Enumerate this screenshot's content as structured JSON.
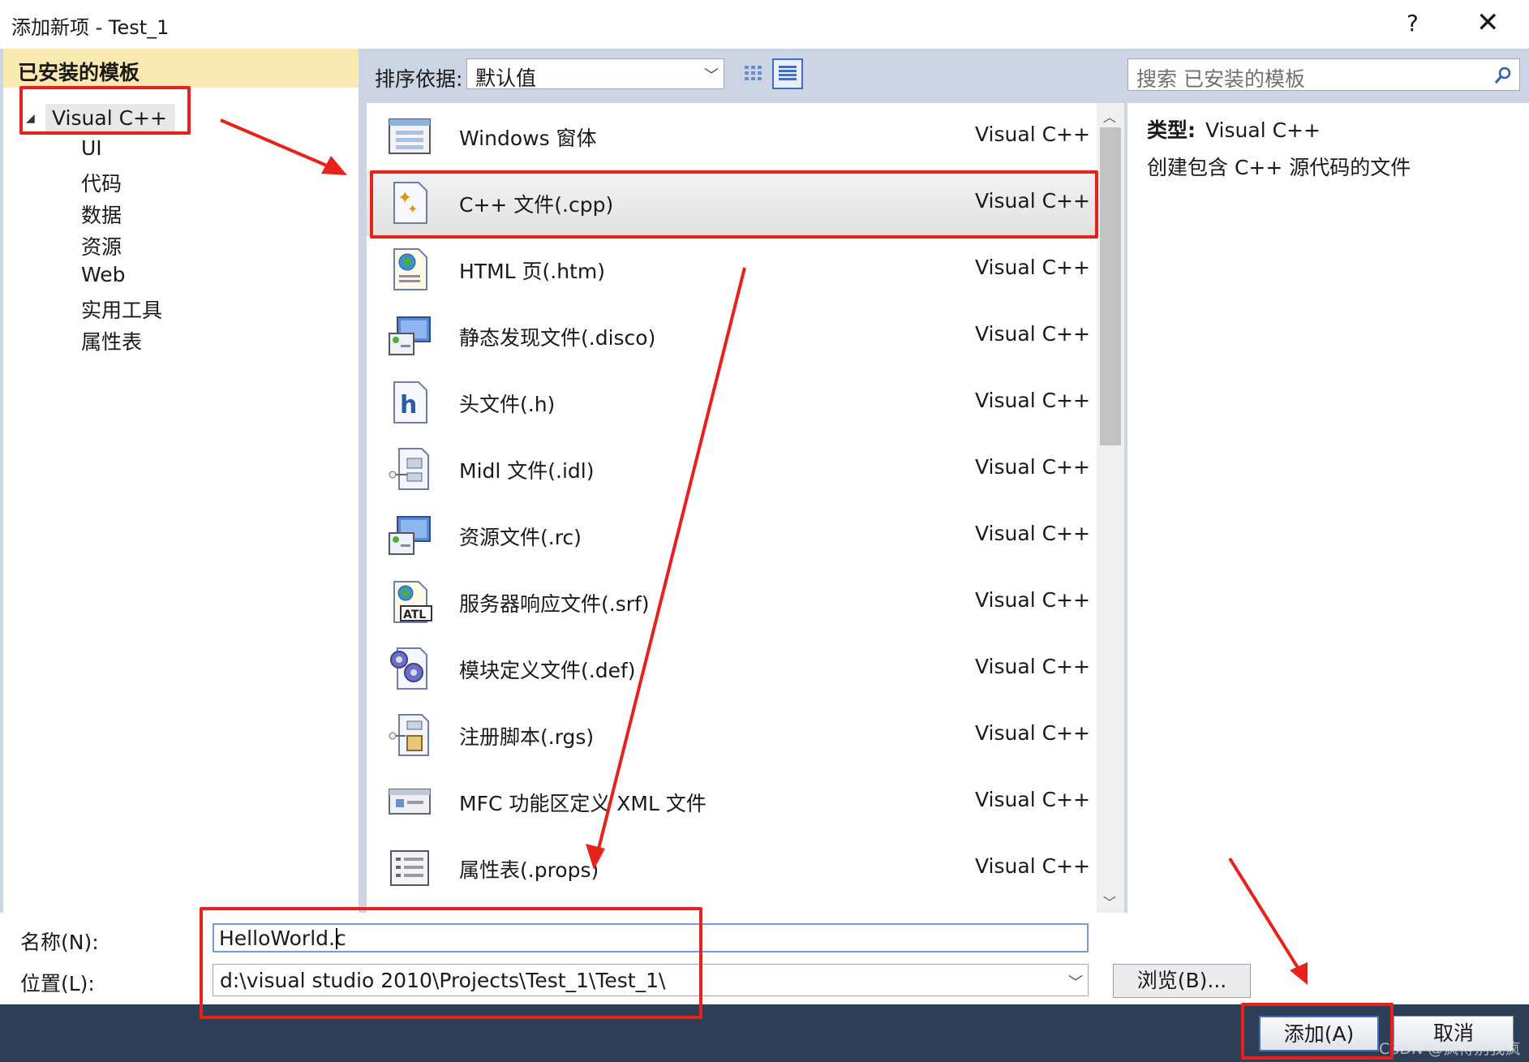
{
  "window": {
    "title": "添加新项 - Test_1",
    "help": "?",
    "close": "✕"
  },
  "left_panel": {
    "header": "已安装的模板",
    "root": "Visual C++",
    "children": [
      "UI",
      "代码",
      "数据",
      "资源",
      "Web",
      "实用工具",
      "属性表"
    ]
  },
  "toolbar": {
    "sort_label": "排序依据:",
    "sort_value": "默认值",
    "search_placeholder": "搜索 已安装的模板"
  },
  "templates": [
    {
      "name": "Windows 窗体",
      "type": "Visual C++",
      "icon": "form-icon"
    },
    {
      "name": "C++ 文件(.cpp)",
      "type": "Visual C++",
      "icon": "cpp-file-icon"
    },
    {
      "name": "HTML 页(.htm)",
      "type": "Visual C++",
      "icon": "html-page-icon"
    },
    {
      "name": "静态发现文件(.disco)",
      "type": "Visual C++",
      "icon": "disco-file-icon"
    },
    {
      "name": "头文件(.h)",
      "type": "Visual C++",
      "icon": "header-file-icon"
    },
    {
      "name": "Midl 文件(.idl)",
      "type": "Visual C++",
      "icon": "idl-file-icon"
    },
    {
      "name": "资源文件(.rc)",
      "type": "Visual C++",
      "icon": "resource-file-icon"
    },
    {
      "name": "服务器响应文件(.srf)",
      "type": "Visual C++",
      "icon": "atl-srf-icon"
    },
    {
      "name": "模块定义文件(.def)",
      "type": "Visual C++",
      "icon": "def-file-icon"
    },
    {
      "name": "注册脚本(.rgs)",
      "type": "Visual C++",
      "icon": "rgs-script-icon"
    },
    {
      "name": "MFC 功能区定义 XML 文件",
      "type": "Visual C++",
      "icon": "ribbon-xml-icon"
    },
    {
      "name": "属性表(.props)",
      "type": "Visual C++",
      "icon": "props-sheet-icon"
    }
  ],
  "selected_template": "C++ 文件(.cpp)",
  "details": {
    "type_label": "类型:",
    "type_value": "Visual C++",
    "description": "创建包含 C++ 源代码的文件"
  },
  "fields": {
    "name_label": "名称(N):",
    "name_value": "HelloWorld.c",
    "location_label": "位置(L):",
    "location_value": "d:\\visual studio 2010\\Projects\\Test_1\\Test_1\\"
  },
  "buttons": {
    "browse": "浏览(B)...",
    "add": "添加(A)",
    "cancel": "取消"
  },
  "watermark": "CSDN @疯得别我疯",
  "colors": {
    "annotation": "#e8221b",
    "left_header": "#fbe9b2",
    "footer": "#2d3e57"
  }
}
